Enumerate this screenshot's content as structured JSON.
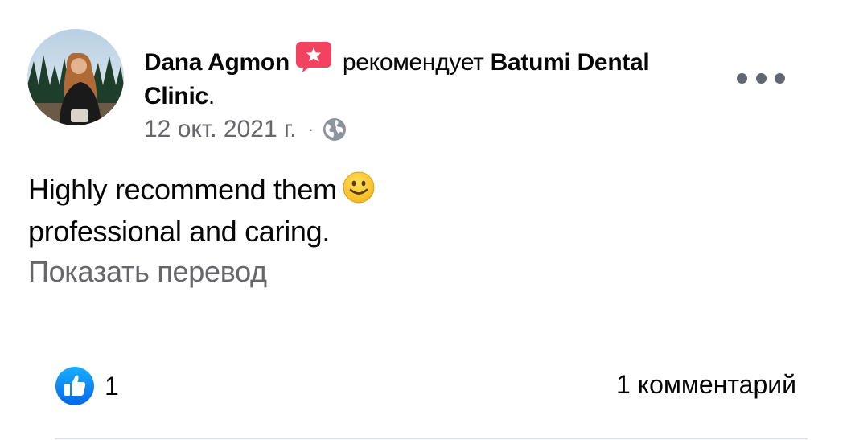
{
  "post": {
    "author": "Dana Agmon",
    "verb": "рекомендует",
    "page_name": "Batumi Dental Clinic",
    "page_suffix": ".",
    "date": "12 окт. 2021 г.",
    "separator": "·",
    "privacy_icon": "globe-icon",
    "recommend_icon": "recommendation-star-icon",
    "more_icon": "ellipsis-icon",
    "text_line1": "Highly recommend them",
    "text_line2": "professional and caring.",
    "emoji": "smiley-icon",
    "translate_label": "Показать перевод"
  },
  "footer": {
    "like_icon": "like-thumb-icon",
    "like_count": "1",
    "comments_label": "1 комментарий"
  },
  "colors": {
    "primary_text": "#050505",
    "secondary_text": "#65676b",
    "recommend_badge": "#f3425f",
    "like_blue": "#1877f2",
    "divider": "#dadde1"
  }
}
